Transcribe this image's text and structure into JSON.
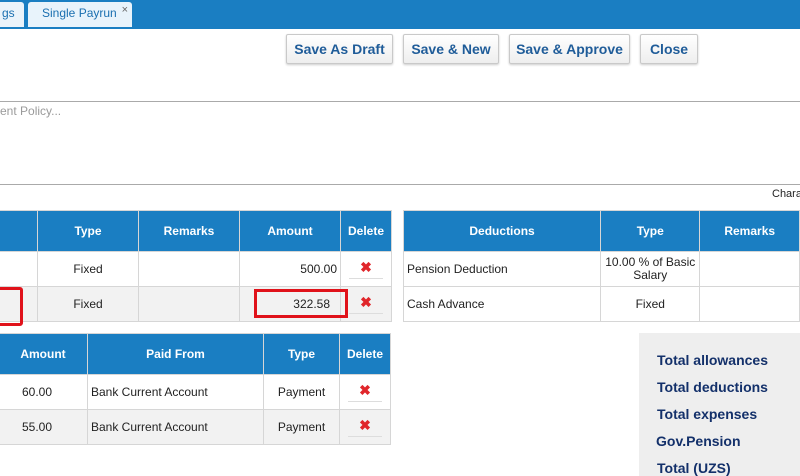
{
  "tabs": {
    "prev_label": "gs",
    "active_label": "Single Payrun",
    "close_glyph": "×"
  },
  "toolbar": {
    "save_draft": "Save As Draft",
    "save_new": "Save & New",
    "save_approve": "Save & Approve",
    "close": "Close"
  },
  "notes": {
    "placeholder": "ent Policy...",
    "chars_label": "Chara"
  },
  "allowances": {
    "headers": [
      "Type",
      "Remarks",
      "Amount",
      "Delete"
    ],
    "rows": [
      {
        "type": "Fixed",
        "remarks": "",
        "amount": "500.00"
      },
      {
        "type": "Fixed",
        "remarks": "",
        "amount": "322.58"
      }
    ]
  },
  "deductions": {
    "headers": [
      "Deductions",
      "Type",
      "Remarks"
    ],
    "rows": [
      {
        "name": "Pension Deduction",
        "type": "10.00 % of Basic Salary"
      },
      {
        "name": "Cash Advance",
        "type": "Fixed"
      }
    ]
  },
  "expenses": {
    "headers": [
      "Amount",
      "Paid From",
      "Type",
      "Delete"
    ],
    "rows": [
      {
        "amount": "60.00",
        "paid_from": "Bank Current Account",
        "type": "Payment"
      },
      {
        "amount": "55.00",
        "paid_from": "Bank Current Account",
        "type": "Payment"
      }
    ]
  },
  "totals": {
    "allowances": "Total allowances",
    "deductions": "Total deductions",
    "expenses": "Total expenses",
    "pension": "Gov.Pension",
    "total": "Total (UZS)"
  },
  "delete_glyph": "✖",
  "colors": {
    "header_blue": "#1a7ec2",
    "highlight_red": "#e0121a",
    "delete_red": "#e0262b",
    "totals_text": "#13306a"
  }
}
